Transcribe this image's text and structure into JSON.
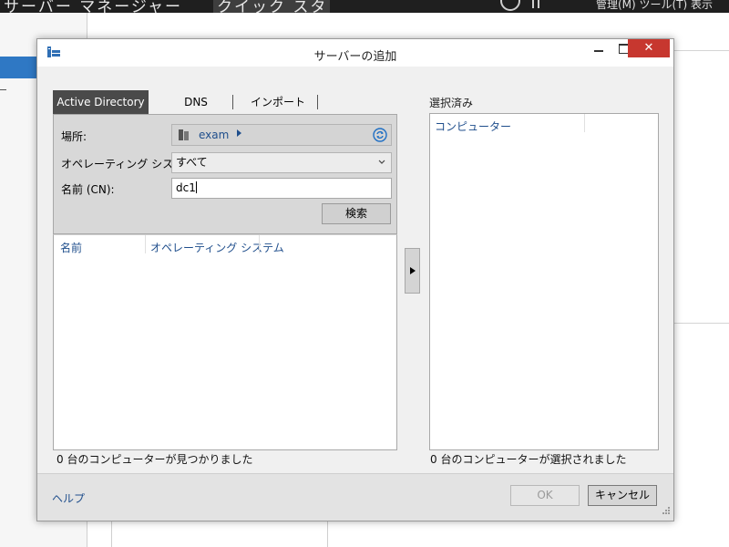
{
  "background_window": {
    "title": "サーバー マネージャー",
    "highlighted_item": "クイック スタート",
    "menu_text": "管理(M)  ツール(T)  表示"
  },
  "dialog": {
    "title": "サーバーの追加",
    "close_glyph": "✕"
  },
  "tabs": [
    {
      "label": "Active Directory",
      "active": true
    },
    {
      "label": "DNS",
      "active": false
    },
    {
      "label": "インポート",
      "active": false
    }
  ],
  "search": {
    "location_label": "場所:",
    "location_value": "exam",
    "os_label": "オペレーティング システム:",
    "os_value": "すべて",
    "name_label": "名前 (CN):",
    "name_value": "dc1",
    "search_button": "検索"
  },
  "results": {
    "columns": [
      "名前",
      "オペレーティング システム"
    ],
    "status": "0 台のコンピューターが見つかりました"
  },
  "selected": {
    "header": "選択済み",
    "column": "コンピューター",
    "status": "0 台のコンピューターが選択されました"
  },
  "footer": {
    "help": "ヘルプ",
    "ok": "OK",
    "cancel": "キャンセル"
  },
  "colors": {
    "accent_link": "#1f4e8c",
    "close_red": "#c7372f",
    "active_tab": "#4a4a4a"
  }
}
